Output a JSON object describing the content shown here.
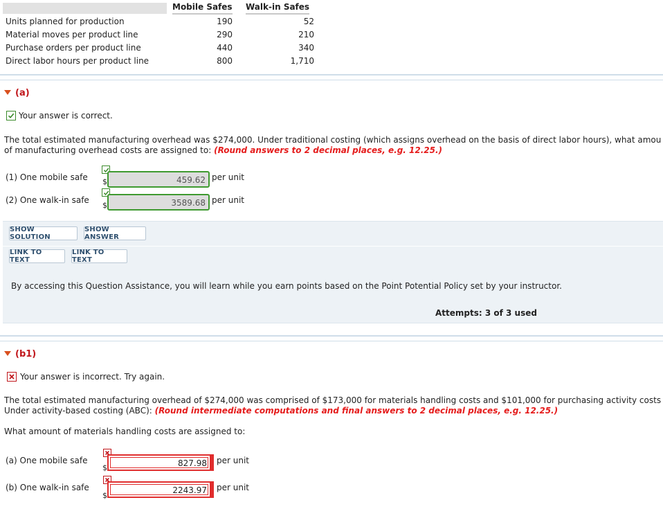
{
  "table": {
    "headers": [
      "Mobile Safes",
      "Walk-in Safes"
    ],
    "rows": [
      {
        "label": "Units planned for production",
        "mobile": "190",
        "walkin": "52"
      },
      {
        "label": "Material moves per product line",
        "mobile": "290",
        "walkin": "210"
      },
      {
        "label": "Purchase orders per product line",
        "mobile": "440",
        "walkin": "340"
      },
      {
        "label": "Direct labor hours per product line",
        "mobile": "800",
        "walkin": "1,710"
      }
    ]
  },
  "part_a": {
    "toggle_label": "(a)",
    "status_text": "Your answer is correct.",
    "question_line1": "The total estimated manufacturing overhead was $274,000. Under traditional costing (which assigns overhead on the basis of direct labor hours), what amou",
    "question_line2_plain": "of manufacturing overhead costs are assigned to: ",
    "question_line2_instruction": "(Round answers to 2 decimal places, e.g. 12.25.)",
    "answers": [
      {
        "label": "(1)  One mobile safe",
        "currency": "$",
        "value": "459.62",
        "unit": "per unit"
      },
      {
        "label": "(2)  One walk-in safe",
        "currency": "$",
        "value": "3589.68",
        "unit": "per unit"
      }
    ],
    "buttons": {
      "show_solution": "SHOW SOLUTION",
      "show_answer": "SHOW ANSWER",
      "link_to_text_1": "LINK TO TEXT",
      "link_to_text_2": "LINK TO TEXT"
    },
    "assistance_note": "By accessing this Question Assistance, you will learn while you earn points based on the Point Potential Policy set by your instructor.",
    "attempts": "Attempts: 3 of 3 used"
  },
  "part_b1": {
    "toggle_label": "(b1)",
    "status_text": "Your answer is incorrect.  Try again.",
    "question_line1": "The total estimated manufacturing overhead of $274,000 was comprised of $173,000 for materials handling costs and $101,000 for purchasing activity costs",
    "question_line2_plain": "Under activity-based costing (ABC): ",
    "question_line2_instruction": "(Round intermediate computations and final answers to 2 decimal places, e.g. 12.25.)",
    "sub_question": "What amount of materials handling costs are assigned to:",
    "answers": [
      {
        "label": "(a)  One mobile safe",
        "currency": "$",
        "value": "827.98",
        "unit": "per unit"
      },
      {
        "label": "(b)  One walk-in safe",
        "currency": "$",
        "value": "2243.97",
        "unit": "per unit"
      }
    ]
  },
  "colors": {
    "correct_green": "#3f9a30",
    "incorrect_red": "#e02d2d",
    "instruction_red": "#e51c1c",
    "toggle_orange": "#d9501e",
    "panel_bg": "#edf2f6"
  }
}
